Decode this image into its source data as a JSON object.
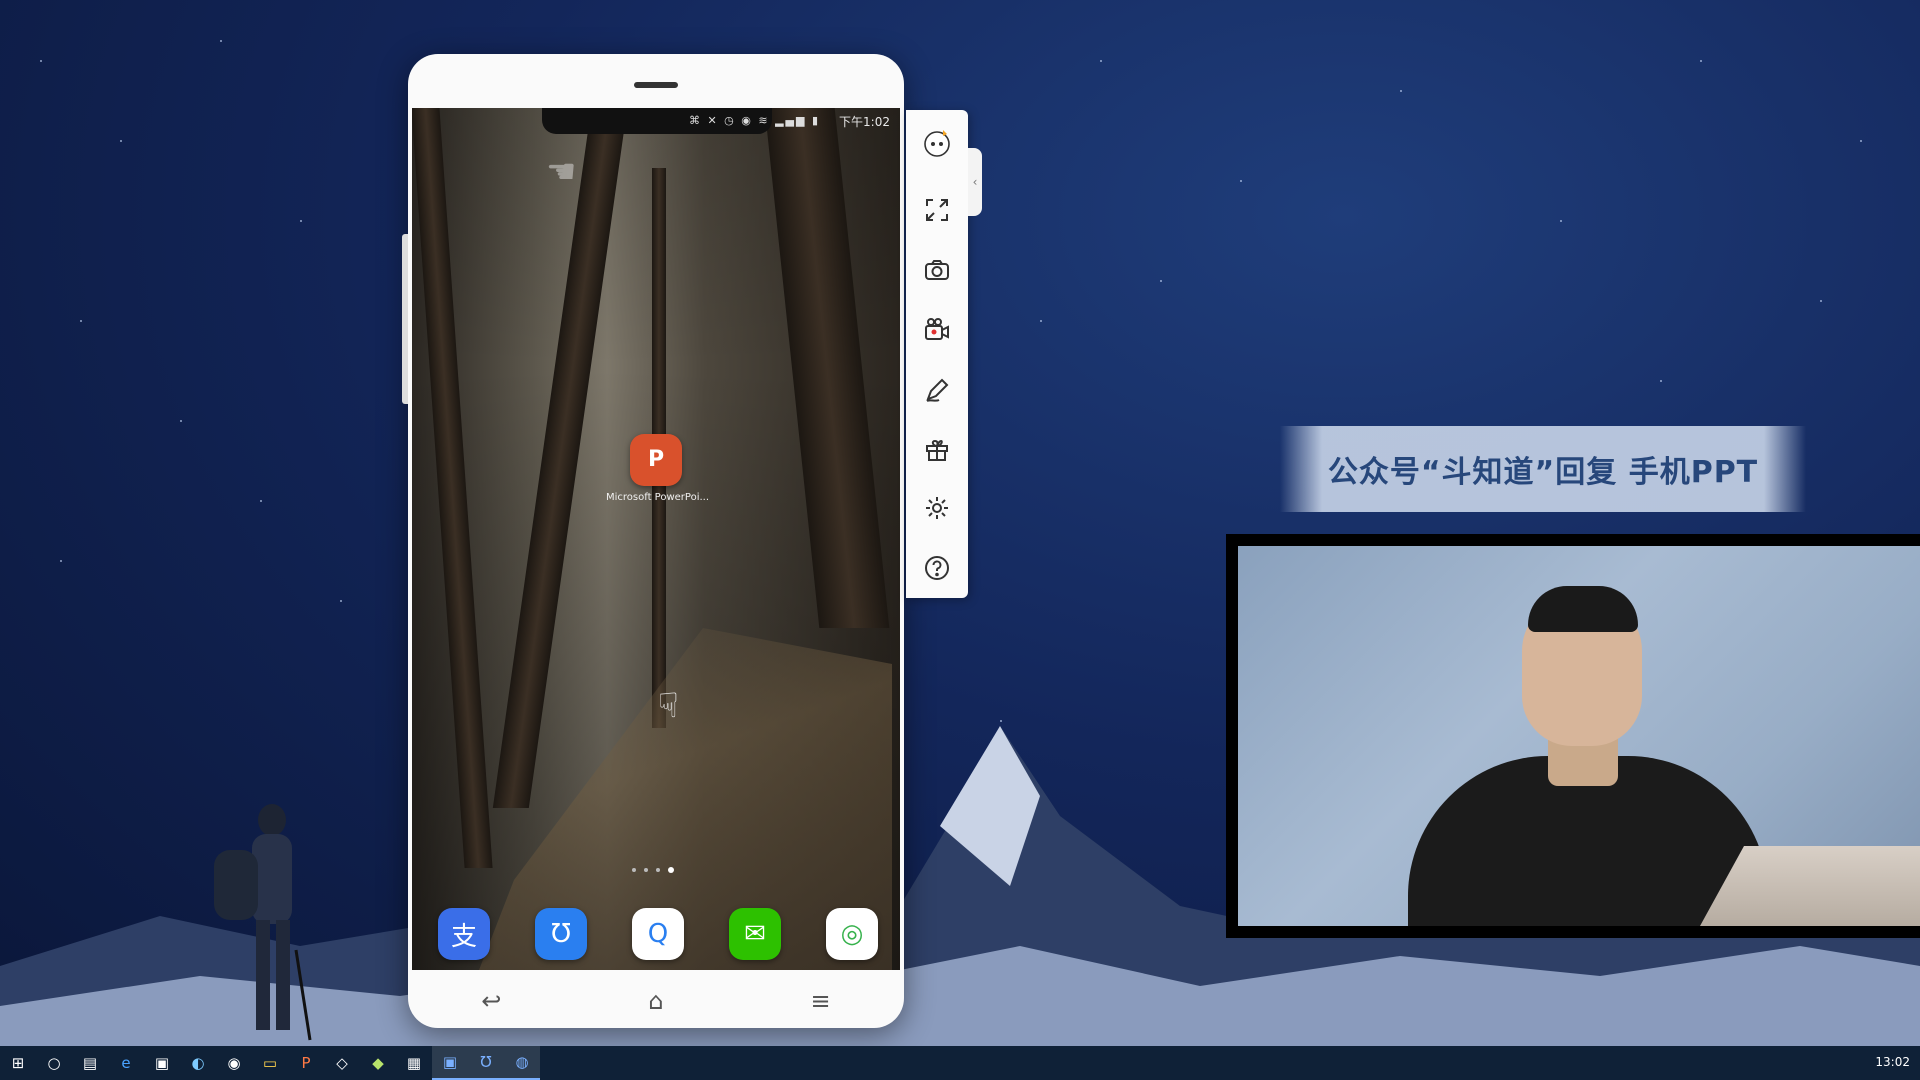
{
  "phone": {
    "status_time": "下午1:02",
    "status_icons": "⌘ ✕ ◷ ◉ ≋ ▂▄▆ ▮",
    "ppt_app": {
      "icon": "P",
      "label": "Microsoft PowerPoi..."
    },
    "dock": [
      {
        "name": "alipay",
        "glyph": "支",
        "color": "#3a6ee8"
      },
      {
        "name": "baidu-netdisk",
        "glyph": "Ʊ",
        "color": "#2a7ff0"
      },
      {
        "name": "qq-browser",
        "glyph": "Q",
        "color": "#ffffff"
      },
      {
        "name": "wechat",
        "glyph": "✉",
        "color": "#2dc100"
      },
      {
        "name": "360-browser",
        "glyph": "◎",
        "color": "#37b24d"
      }
    ],
    "android_nav": {
      "back": "◁",
      "home": "○",
      "recents": "□"
    },
    "frame_nav": {
      "back": "↩",
      "home": "⌂",
      "menu": "≡"
    }
  },
  "toolbar": {
    "collapse": "‹"
  },
  "banner": {
    "text": "公众号“斗知道”回复 手机PPT"
  },
  "taskbar": {
    "items": [
      "⊞",
      "○",
      "▤",
      "e",
      "▣",
      "◐",
      "◉",
      "▭",
      "P",
      "◇",
      "◆",
      "▦",
      "▣",
      "Ʊ",
      "◍"
    ],
    "clock": "13:02"
  }
}
